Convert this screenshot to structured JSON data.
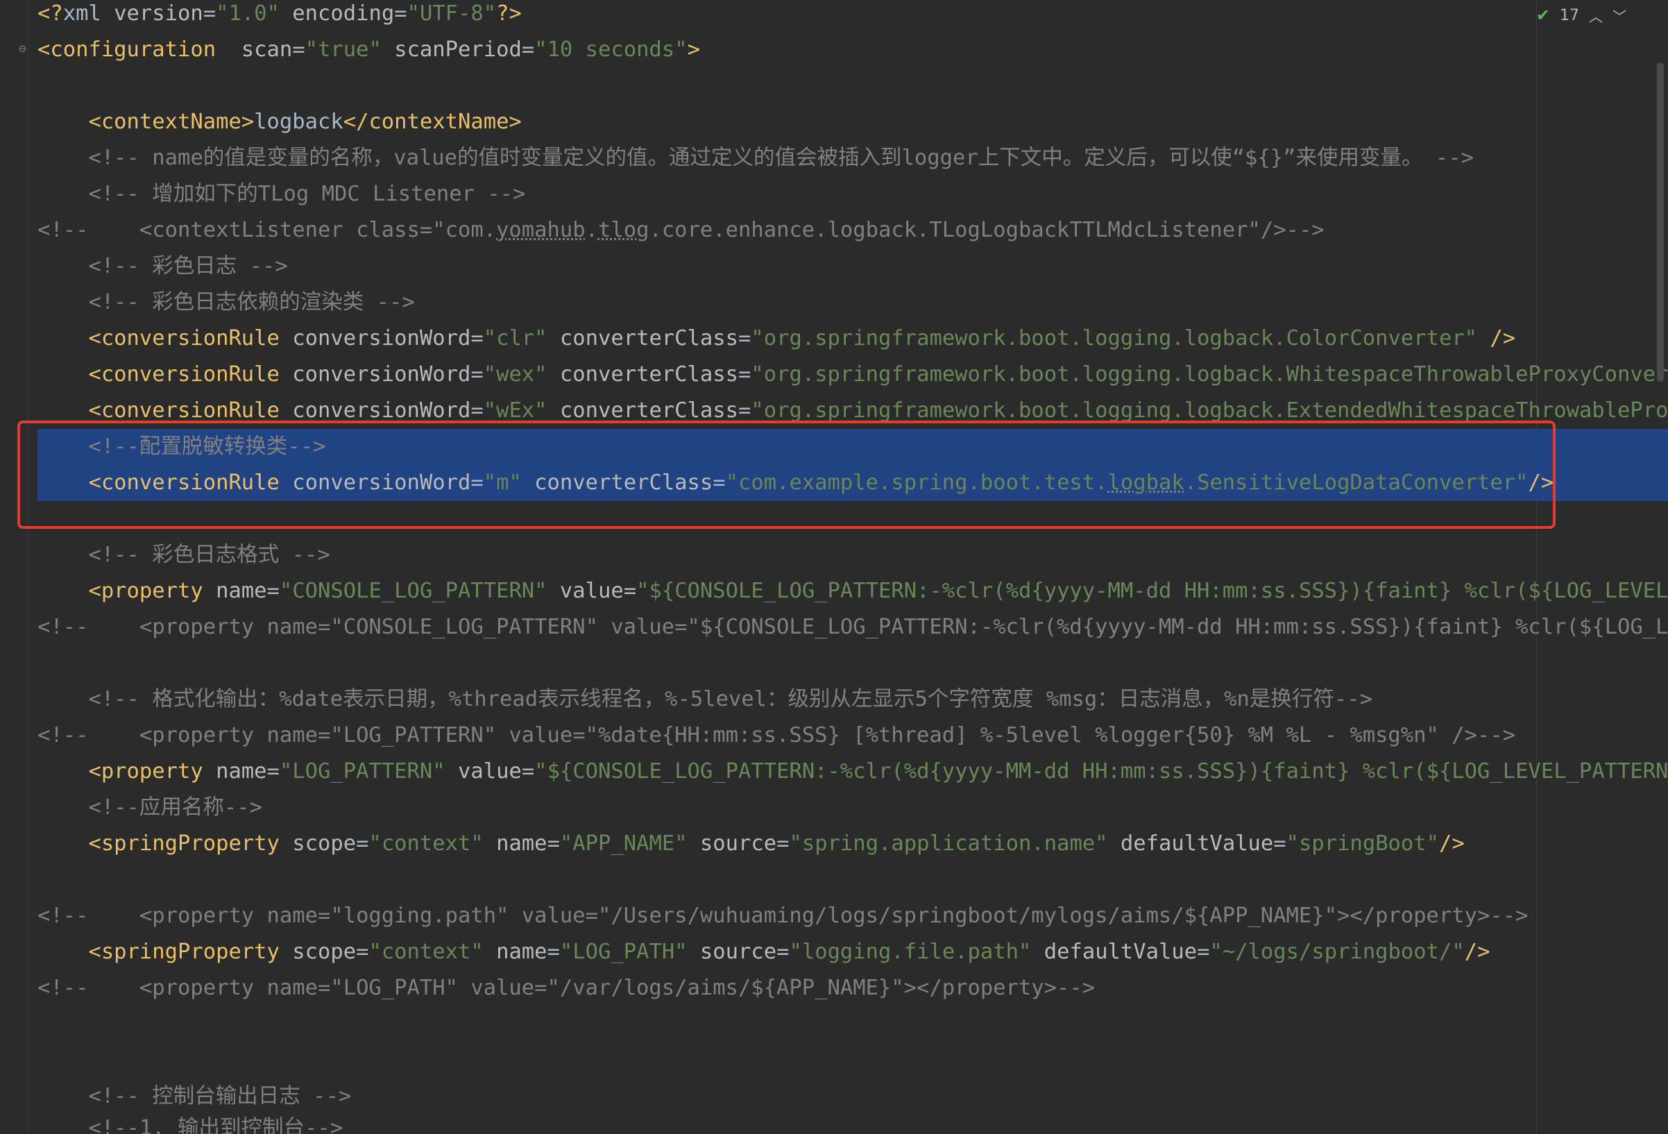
{
  "inspection": {
    "count": "17",
    "status_icon": "check-icon",
    "prev_icon": "chevron-up-icon",
    "next_icon": "chevron-down-icon"
  },
  "colors": {
    "tag": "#e8bf6a",
    "attribute": "#bababa",
    "value": "#6a8759",
    "comment": "#808080",
    "text": "#a9b7c6",
    "selection": "#214283",
    "highlight_box": "#e33d2f"
  },
  "code": {
    "l1": {
      "p1": "<?",
      "p2": "xml ",
      "p3": "version",
      "p4": "=",
      "p5": "\"1.0\"",
      "p6": " encoding",
      "p7": "=",
      "p8": "\"UTF-8\"",
      "p9": "?>"
    },
    "l2": {
      "p1": "<configuration",
      "p2": "  scan",
      "p3": "=",
      "p4": "\"true\"",
      "p5": " scanPeriod",
      "p6": "=",
      "p7": "\"10 seconds\"",
      "p8": ">"
    },
    "l4": {
      "p1": "    <contextName>",
      "p2": "logback",
      "p3": "</contextName>"
    },
    "l5": "    <!-- name的值是变量的名称，value的值时变量定义的值。通过定义的值会被插入到logger上下文中。定义后，可以使“${}”来使用变量。 -->",
    "l6": "    <!-- 增加如下的TLog MDC Listener -->",
    "l7": {
      "p1": "<!--    <contextListener class=\"com.",
      "p2": "yomahub",
      "p3": ".",
      "p4": "tlog",
      "p5": ".core.enhance.logback.TLogLogbackTTLMdcListener\"/>-->"
    },
    "l8": "    <!-- 彩色日志 -->",
    "l9": "    <!-- 彩色日志依赖的渲染类 -->",
    "l10": {
      "p1": "    <conversionRule",
      "p2": " conversionWord",
      "p3": "=",
      "p4": "\"clr\"",
      "p5": " converterClass",
      "p6": "=",
      "p7": "\"org.springframework.boot.logging.logback.ColorConverter\"",
      "p8": " />"
    },
    "l11": {
      "p1": "    <conversionRule",
      "p2": " conversionWord",
      "p3": "=",
      "p4": "\"wex\"",
      "p5": " converterClass",
      "p6": "=",
      "p7": "\"org.springframework.boot.logging.logback.WhitespaceThrowableProxyConverter"
    },
    "l12": {
      "p1": "    <conversionRule",
      "p2": " conversionWord",
      "p3": "=",
      "p4": "\"wEx\"",
      "p5": " converterClass",
      "p6": "=",
      "p7": "\"org.springframework.boot.logging.logback.ExtendedWhitespaceThrowableProxyC"
    },
    "l13": "    <!--配置脱敏转换类-->",
    "l14": {
      "p1": "    <conversionRule",
      "p2": " conversionWord",
      "p3": "=",
      "p4": "\"m\"",
      "p5": " converterClass",
      "p6": "=",
      "p7": "\"com.example.spring.boot.test.",
      "p8": "logbak",
      "p9": ".SensitiveLogDataConverter\"",
      "p10": "/>"
    },
    "l16": "    <!-- 彩色日志格式 -->",
    "l17": {
      "p1": "    <property",
      "p2": " name",
      "p3": "=",
      "p4": "\"CONSOLE_LOG_PATTERN\"",
      "p5": " value",
      "p6": "=",
      "p7": "\"${CONSOLE_LOG_PATTERN:-%clr(%d{yyyy-MM-dd HH:mm:ss.SSS}){faint} %clr(${LOG_LEVEL_PA"
    },
    "l18": "<!--    <property name=\"CONSOLE_LOG_PATTERN\" value=\"${CONSOLE_LOG_PATTERN:-%clr(%d{yyyy-MM-dd HH:mm:ss.SSS}){faint} %clr(${LOG_LEVE",
    "l20": "    <!-- 格式化输出：%date表示日期，%thread表示线程名，%-5level：级别从左显示5个字符宽度 %msg：日志消息，%n是换行符-->",
    "l21": "<!--    <property name=\"LOG_PATTERN\" value=\"%date{HH:mm:ss.SSS} [%thread] %-5level %logger{50} %M %L - %msg%n\" />-->",
    "l22": {
      "p1": "    <property",
      "p2": " name",
      "p3": "=",
      "p4": "\"LOG_PATTERN\"",
      "p5": " value",
      "p6": "=",
      "p7": "\"${CONSOLE_LOG_PATTERN:-%clr(%d{yyyy-MM-dd HH:mm:ss.SSS}){faint} %clr(${LOG_LEVEL_PATTERN:-%"
    },
    "l23": "    <!--应用名称-->",
    "l24": {
      "p1": "    <springProperty",
      "p2": " scope",
      "p3": "=",
      "p4": "\"context\"",
      "p5": " name",
      "p6": "=",
      "p7": "\"APP_NAME\"",
      "p8": " source",
      "p9": "=",
      "p10": "\"spring.application.name\"",
      "p11": " defaultValue",
      "p12": "=",
      "p13": "\"springBoot\"",
      "p14": "/>"
    },
    "l26": "<!--    <property name=\"logging.path\" value=\"/Users/wuhuaming/logs/springboot/mylogs/aims/${APP_NAME}\"></property>-->",
    "l27": {
      "p1": "    <springProperty",
      "p2": " scope",
      "p3": "=",
      "p4": "\"context\"",
      "p5": " name",
      "p6": "=",
      "p7": "\"LOG_PATH\"",
      "p8": " source",
      "p9": "=",
      "p10": "\"logging.file.path\"",
      "p11": " defaultValue",
      "p12": "=",
      "p13": "\"~/logs/springboot/\"",
      "p14": "/>"
    },
    "l28": "<!--    <property name=\"LOG_PATH\" value=\"/var/logs/aims/${APP_NAME}\"></property>-->",
    "l32": "    <!-- 控制台输出日志 -->",
    "l33": "    <!--1. 输出到控制台-->"
  }
}
